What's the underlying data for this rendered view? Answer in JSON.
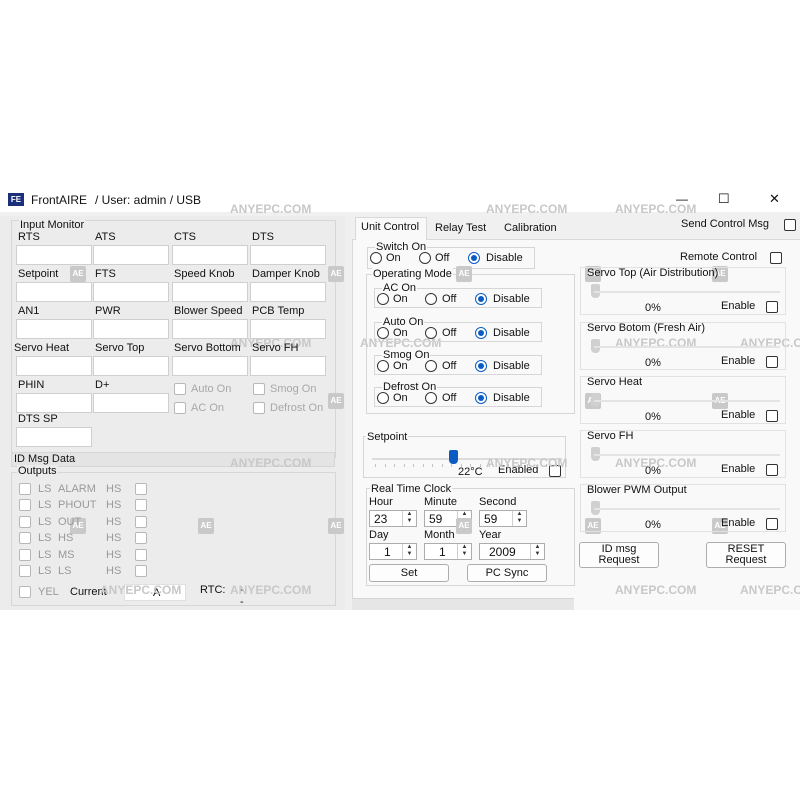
{
  "titlebar": {
    "app_name": "FrontAIRE",
    "user_text": "/ User: admin / USB",
    "minimize": "—",
    "maximize": "☐",
    "close": "✕"
  },
  "input_monitor": {
    "title": "Input Monitor",
    "fields": [
      "RTS",
      "ATS",
      "CTS",
      "DTS",
      "Setpoint",
      "FTS",
      "Speed Knob",
      "Damper Knob",
      "AN1",
      "PWR",
      "Blower Speed",
      "PCB Temp",
      "Servo Heat",
      "Servo Top",
      "Servo Bottom",
      "Servo FH",
      "PHIN",
      "D+",
      "DTS SP"
    ],
    "auto_on": "Auto On",
    "smog_on": "Smog On",
    "ac_on": "AC On",
    "defrost_on": "Defrost On"
  },
  "id_msg": {
    "title": "ID Msg Data"
  },
  "outputs": {
    "title": "Outputs",
    "rows": [
      {
        "left": "LS",
        "mid": "ALARM",
        "right": "HS"
      },
      {
        "left": "LS",
        "mid": "PHOUT",
        "right": "HS"
      },
      {
        "left": "LS",
        "mid": "OUT",
        "right": "HS"
      },
      {
        "left": "LS",
        "mid": "HS",
        "right": "HS"
      },
      {
        "left": "LS",
        "mid": "MS",
        "right": "HS"
      },
      {
        "left": "LS",
        "mid": "LS",
        "right": "HS"
      }
    ],
    "last_label": "YEL"
  },
  "status": {
    "current_label": "Current",
    "current_value": "A",
    "rtc_label": "RTC:",
    "rtc_value": "-",
    "rtc_value2": "-"
  },
  "tabs": [
    "Unit Control",
    "Relay Test",
    "Calibration"
  ],
  "send_control_msg": "Send Control Msg",
  "remote_control": "Remote Control",
  "switch_on": {
    "title": "Switch On",
    "on": "On",
    "off": "Off",
    "disable": "Disable"
  },
  "operating_mode": {
    "title": "Operating Mode",
    "groups": [
      {
        "title": "AC On",
        "on": "On",
        "off": "Off",
        "disable": "Disable"
      },
      {
        "title": "Auto On",
        "on": "On",
        "off": "Off",
        "disable": "Disable"
      },
      {
        "title": "Smog On",
        "on": "On",
        "off": "Off",
        "disable": "Disable"
      },
      {
        "title": "Defrost On",
        "on": "On",
        "off": "Off",
        "disable": "Disable"
      }
    ]
  },
  "setpoint": {
    "title": "Setpoint",
    "value": "22°C",
    "enabled": "Enabled",
    "position": 0.45
  },
  "rtc": {
    "title": "Real Time Clock",
    "hour_label": "Hour",
    "hour": "23",
    "minute_label": "Minute",
    "minute": "59",
    "second_label": "Second",
    "second": "59",
    "day_label": "Day",
    "day": "1",
    "month_label": "Month",
    "month": "1",
    "year_label": "Year",
    "year": "2009",
    "set": "Set",
    "pc_sync": "PC Sync"
  },
  "servos": [
    {
      "title": "Servo Top (Air Distribution)",
      "percent": "0%",
      "enable": "Enable"
    },
    {
      "title": "Servo Botom (Fresh Air)",
      "percent": "0%",
      "enable": "Enable"
    },
    {
      "title": "Servo Heat",
      "percent": "0%",
      "enable": "Enable"
    },
    {
      "title": "Servo FH",
      "percent": "0%",
      "enable": "Enable"
    },
    {
      "title": "Blower PWM Output",
      "percent": "0%",
      "enable": "Enable"
    }
  ],
  "id_msg_request": "ID msg Request",
  "reset_request": "RESET Request",
  "watermark": {
    "text": "ANYEPC.COM",
    "icon": "AE"
  }
}
